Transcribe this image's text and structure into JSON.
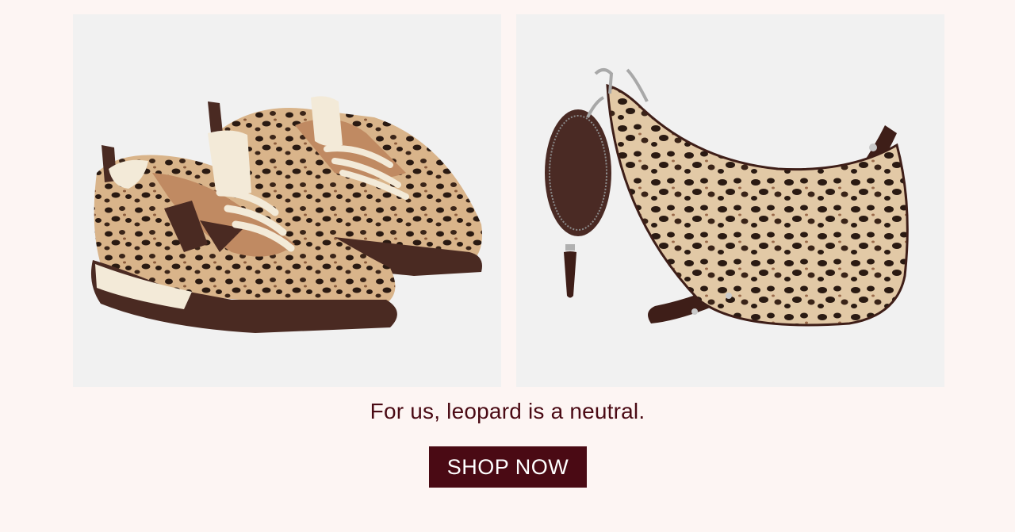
{
  "products": [
    {
      "name": "leopard-sneakers"
    },
    {
      "name": "leopard-crescent-bag"
    }
  ],
  "tagline": "For us, leopard is a neutral.",
  "cta": {
    "label": "SHOP NOW"
  },
  "colors": {
    "background": "#fdf5f3",
    "panel": "#f1f1f1",
    "brand": "#4a0a14",
    "leopard_base": "#d9b48a",
    "leopard_spot": "#2a1a12",
    "sole": "#4a2a22",
    "suede": "#c08a62",
    "cream": "#f3ead8"
  }
}
